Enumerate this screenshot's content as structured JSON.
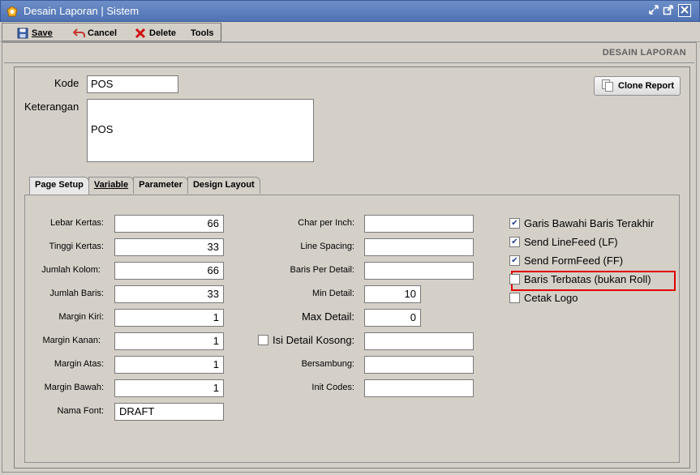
{
  "window": {
    "title": "Desain Laporan | Sistem"
  },
  "toolbar": {
    "save": "Save",
    "cancel": "Cancel",
    "delete": "Delete",
    "tools": "Tools"
  },
  "heading": "DESAIN LAPORAN",
  "form": {
    "kode_label": "Kode",
    "kode_value": "POS",
    "keterangan_label": "Keterangan",
    "keterangan_value": "POS",
    "clone_button": "Clone Report"
  },
  "tabs": [
    "Page Setup",
    "Variable",
    "Parameter",
    "Design Layout"
  ],
  "page_setup": {
    "left": [
      {
        "label": "Lebar Kertas:",
        "value": "66"
      },
      {
        "label": "Tinggi Kertas:",
        "value": "33"
      },
      {
        "label": "Jumlah Kolom:",
        "value": "66"
      },
      {
        "label": "Jumlah Baris:",
        "value": "33"
      },
      {
        "label": "Margin Kiri:",
        "value": "1"
      },
      {
        "label": "Margin Kanan:",
        "value": "1"
      },
      {
        "label": "Margin Atas:",
        "value": "1"
      },
      {
        "label": "Margin Bawah:",
        "value": "1"
      }
    ],
    "nama_font_label": "Nama Font:",
    "nama_font_value": "DRAFT",
    "middle": [
      {
        "label": "Char per Inch:",
        "value": ""
      },
      {
        "label": "Line Spacing:",
        "value": ""
      },
      {
        "label": "Baris Per Detail:",
        "value": ""
      },
      {
        "label": "Min Detail:",
        "value": "10"
      },
      {
        "label": "Max Detail:",
        "value": "0"
      },
      {
        "label": "Isi Detail Kosong:",
        "value": ""
      },
      {
        "label": "Bersambung:",
        "value": ""
      },
      {
        "label": "Init Codes:",
        "value": ""
      }
    ],
    "checkboxes": [
      {
        "label": "Garis Bawahi Baris Terakhir",
        "checked": true
      },
      {
        "label": "Send LineFeed (LF)",
        "checked": true
      },
      {
        "label": "Send FormFeed (FF)",
        "checked": true
      },
      {
        "label": "Baris Terbatas (bukan Roll)",
        "checked": false
      },
      {
        "label": "Cetak Logo",
        "checked": false
      }
    ],
    "highlight_color": "#e00000"
  }
}
